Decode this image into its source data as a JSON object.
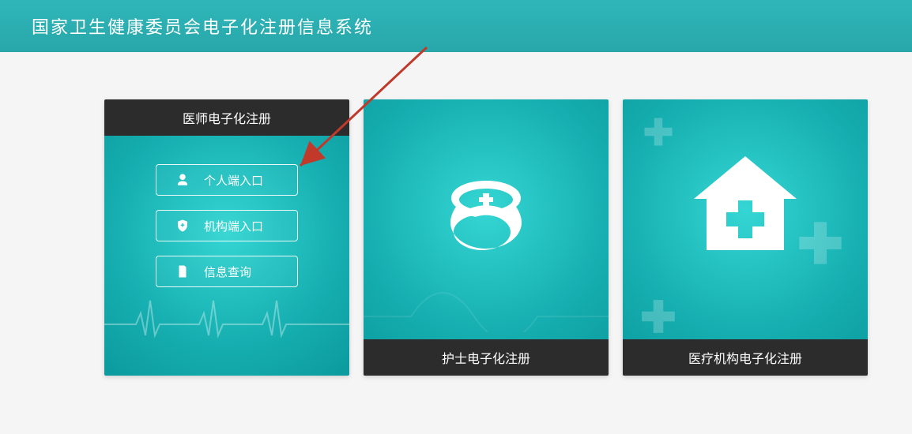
{
  "header": {
    "title": "国家卫生健康委员会电子化注册信息系统"
  },
  "cards": [
    {
      "title": "医师电子化注册",
      "title_pos": "top",
      "buttons": [
        {
          "icon": "user-icon",
          "label": "个人端入口"
        },
        {
          "icon": "shield-icon",
          "label": "机构端入口"
        },
        {
          "icon": "search-icon",
          "label": "信息查询"
        }
      ]
    },
    {
      "title": "护士电子化注册",
      "title_pos": "bottom",
      "icon": "nurse-cap-icon"
    },
    {
      "title": "医疗机构电子化注册",
      "title_pos": "bottom",
      "icon": "hospital-house-icon"
    }
  ],
  "colors": {
    "accent": "#18b0b2",
    "headerBg": "#2fb6b9",
    "titleBar": "#2c2c2c",
    "annotation": "#c0392b"
  },
  "annotation_arrow": true
}
